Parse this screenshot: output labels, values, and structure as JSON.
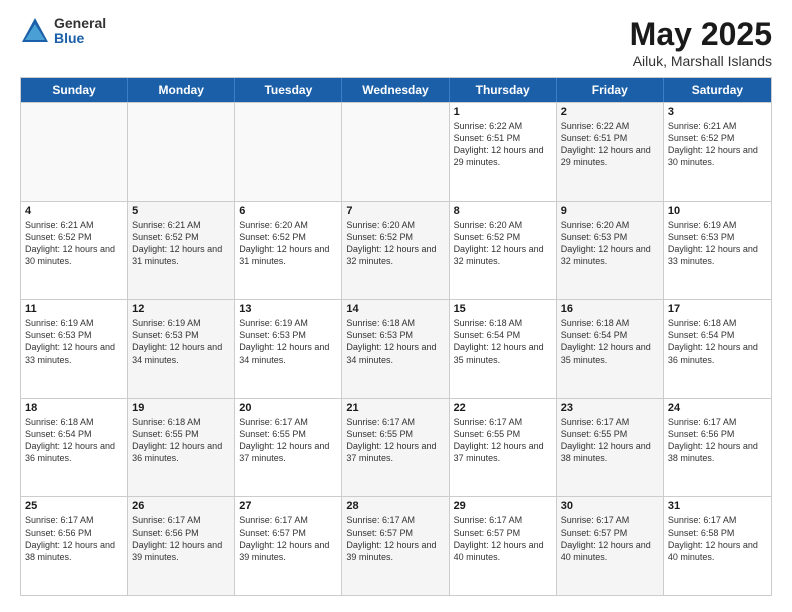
{
  "logo": {
    "general": "General",
    "blue": "Blue"
  },
  "header": {
    "title": "May 2025",
    "subtitle": "Ailuk, Marshall Islands"
  },
  "days": [
    "Sunday",
    "Monday",
    "Tuesday",
    "Wednesday",
    "Thursday",
    "Friday",
    "Saturday"
  ],
  "weeks": [
    [
      {
        "num": "",
        "text": ""
      },
      {
        "num": "",
        "text": ""
      },
      {
        "num": "",
        "text": ""
      },
      {
        "num": "",
        "text": ""
      },
      {
        "num": "1",
        "text": "Sunrise: 6:22 AM\nSunset: 6:51 PM\nDaylight: 12 hours and 29 minutes."
      },
      {
        "num": "2",
        "text": "Sunrise: 6:22 AM\nSunset: 6:51 PM\nDaylight: 12 hours and 29 minutes."
      },
      {
        "num": "3",
        "text": "Sunrise: 6:21 AM\nSunset: 6:52 PM\nDaylight: 12 hours and 30 minutes."
      }
    ],
    [
      {
        "num": "4",
        "text": "Sunrise: 6:21 AM\nSunset: 6:52 PM\nDaylight: 12 hours and 30 minutes."
      },
      {
        "num": "5",
        "text": "Sunrise: 6:21 AM\nSunset: 6:52 PM\nDaylight: 12 hours and 31 minutes."
      },
      {
        "num": "6",
        "text": "Sunrise: 6:20 AM\nSunset: 6:52 PM\nDaylight: 12 hours and 31 minutes."
      },
      {
        "num": "7",
        "text": "Sunrise: 6:20 AM\nSunset: 6:52 PM\nDaylight: 12 hours and 32 minutes."
      },
      {
        "num": "8",
        "text": "Sunrise: 6:20 AM\nSunset: 6:52 PM\nDaylight: 12 hours and 32 minutes."
      },
      {
        "num": "9",
        "text": "Sunrise: 6:20 AM\nSunset: 6:53 PM\nDaylight: 12 hours and 32 minutes."
      },
      {
        "num": "10",
        "text": "Sunrise: 6:19 AM\nSunset: 6:53 PM\nDaylight: 12 hours and 33 minutes."
      }
    ],
    [
      {
        "num": "11",
        "text": "Sunrise: 6:19 AM\nSunset: 6:53 PM\nDaylight: 12 hours and 33 minutes."
      },
      {
        "num": "12",
        "text": "Sunrise: 6:19 AM\nSunset: 6:53 PM\nDaylight: 12 hours and 34 minutes."
      },
      {
        "num": "13",
        "text": "Sunrise: 6:19 AM\nSunset: 6:53 PM\nDaylight: 12 hours and 34 minutes."
      },
      {
        "num": "14",
        "text": "Sunrise: 6:18 AM\nSunset: 6:53 PM\nDaylight: 12 hours and 34 minutes."
      },
      {
        "num": "15",
        "text": "Sunrise: 6:18 AM\nSunset: 6:54 PM\nDaylight: 12 hours and 35 minutes."
      },
      {
        "num": "16",
        "text": "Sunrise: 6:18 AM\nSunset: 6:54 PM\nDaylight: 12 hours and 35 minutes."
      },
      {
        "num": "17",
        "text": "Sunrise: 6:18 AM\nSunset: 6:54 PM\nDaylight: 12 hours and 36 minutes."
      }
    ],
    [
      {
        "num": "18",
        "text": "Sunrise: 6:18 AM\nSunset: 6:54 PM\nDaylight: 12 hours and 36 minutes."
      },
      {
        "num": "19",
        "text": "Sunrise: 6:18 AM\nSunset: 6:55 PM\nDaylight: 12 hours and 36 minutes."
      },
      {
        "num": "20",
        "text": "Sunrise: 6:17 AM\nSunset: 6:55 PM\nDaylight: 12 hours and 37 minutes."
      },
      {
        "num": "21",
        "text": "Sunrise: 6:17 AM\nSunset: 6:55 PM\nDaylight: 12 hours and 37 minutes."
      },
      {
        "num": "22",
        "text": "Sunrise: 6:17 AM\nSunset: 6:55 PM\nDaylight: 12 hours and 37 minutes."
      },
      {
        "num": "23",
        "text": "Sunrise: 6:17 AM\nSunset: 6:55 PM\nDaylight: 12 hours and 38 minutes."
      },
      {
        "num": "24",
        "text": "Sunrise: 6:17 AM\nSunset: 6:56 PM\nDaylight: 12 hours and 38 minutes."
      }
    ],
    [
      {
        "num": "25",
        "text": "Sunrise: 6:17 AM\nSunset: 6:56 PM\nDaylight: 12 hours and 38 minutes."
      },
      {
        "num": "26",
        "text": "Sunrise: 6:17 AM\nSunset: 6:56 PM\nDaylight: 12 hours and 39 minutes."
      },
      {
        "num": "27",
        "text": "Sunrise: 6:17 AM\nSunset: 6:57 PM\nDaylight: 12 hours and 39 minutes."
      },
      {
        "num": "28",
        "text": "Sunrise: 6:17 AM\nSunset: 6:57 PM\nDaylight: 12 hours and 39 minutes."
      },
      {
        "num": "29",
        "text": "Sunrise: 6:17 AM\nSunset: 6:57 PM\nDaylight: 12 hours and 40 minutes."
      },
      {
        "num": "30",
        "text": "Sunrise: 6:17 AM\nSunset: 6:57 PM\nDaylight: 12 hours and 40 minutes."
      },
      {
        "num": "31",
        "text": "Sunrise: 6:17 AM\nSunset: 6:58 PM\nDaylight: 12 hours and 40 minutes."
      }
    ]
  ]
}
